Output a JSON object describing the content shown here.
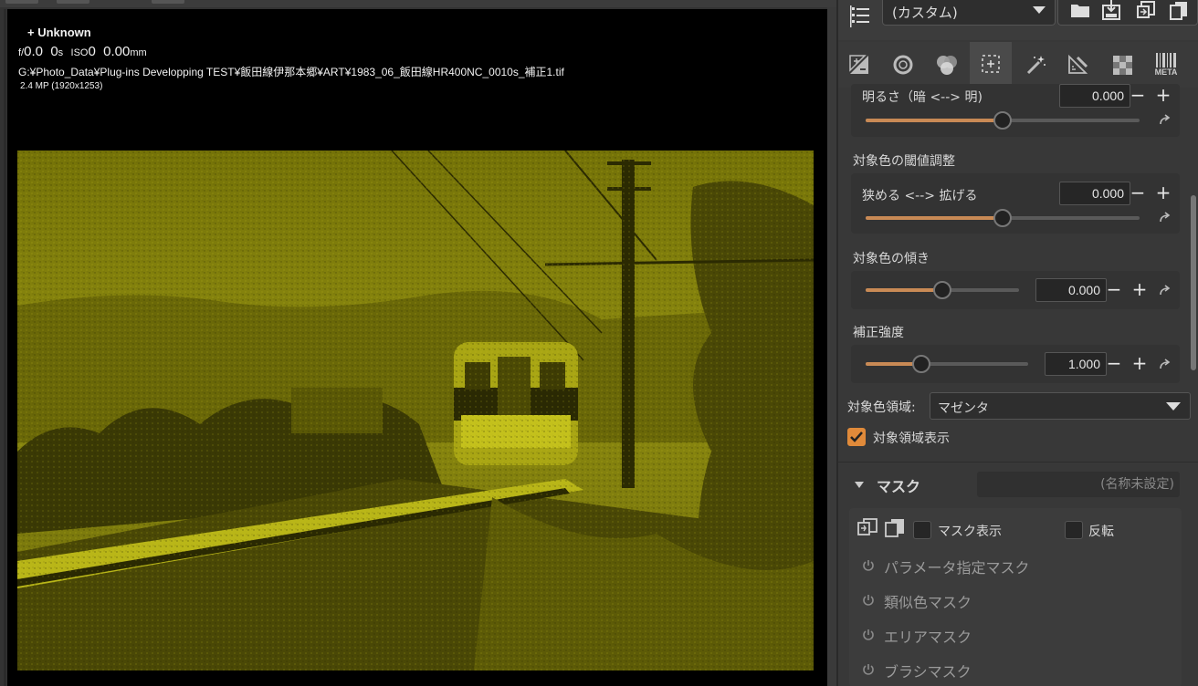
{
  "viewer": {
    "camera": "+ Unknown",
    "f_prefix": "f/",
    "aperture": "0.0",
    "shutter": "0",
    "shutter_unit": "s",
    "iso_label": "ISO",
    "iso": "0",
    "focal": "0.00",
    "focal_unit": "mm",
    "path": "G:¥Photo_Data¥Plug-ins Developping TEST¥飯田線伊那本郷¥ART¥1983_06_飯田線HR400NC_0010s_補正1.tif",
    "megapixels": "2.4 MP (1920x1253)"
  },
  "toolbar": {
    "preset": "(カスタム)",
    "buttons": [
      "list-icon",
      "folder-open-icon",
      "save-icon",
      "paste-settings-icon",
      "copy-settings-icon"
    ]
  },
  "tabs": [
    {
      "name": "exposure-tab-icon",
      "active": false
    },
    {
      "name": "lens-tab-icon",
      "active": false
    },
    {
      "name": "color-tab-icon",
      "active": false
    },
    {
      "name": "local-adjust-tab-icon",
      "active": true
    },
    {
      "name": "retouch-wand-tab-icon",
      "active": false
    },
    {
      "name": "transform-tab-icon",
      "active": false
    },
    {
      "name": "detail-tab-icon",
      "active": false
    },
    {
      "name": "metadata-tab-icon",
      "active": false
    }
  ],
  "meta_label": "META",
  "controls": {
    "brightness": {
      "label": "明るさ（暗 <--> 明)",
      "value": "0.000",
      "position": 0.5
    },
    "threshold_title": "対象色の閾値調整",
    "threshold": {
      "label": "狭める <--> 拡げる",
      "value": "0.000",
      "position": 0.5
    },
    "tilt_title": "対象色の傾き",
    "tilt": {
      "value": "0.000",
      "position": 0.5
    },
    "strength_title": "補正強度",
    "strength": {
      "value": "1.000",
      "position": 0.34
    },
    "area_label": "対象色領域:",
    "area_value": "マゼンタ",
    "show_area_label": "対象領域表示",
    "show_area_checked": true
  },
  "mask": {
    "title": "マスク",
    "name_placeholder": "(名称未設定)",
    "show_mask_label": "マスク表示",
    "invert_label": "反転",
    "items": [
      "パラメータ指定マスク",
      "類似色マスク",
      "エリアマスク",
      "ブラシマスク"
    ]
  },
  "colors": {
    "accent": "#e39a4d",
    "photo_tint": "#8c8a0c"
  }
}
